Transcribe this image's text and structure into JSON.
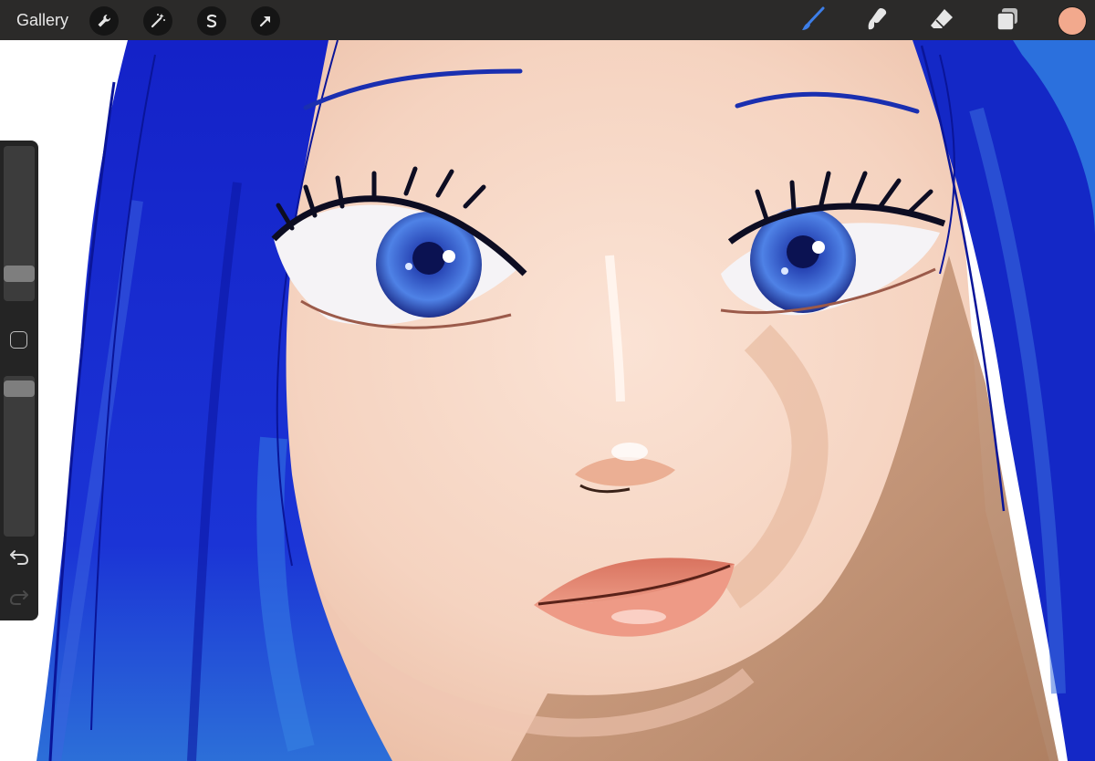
{
  "toolbar": {
    "gallery_label": "Gallery",
    "left_tools": [
      "wrench-icon",
      "magic-wand-icon",
      "selection-s-icon",
      "transform-arrow-icon"
    ],
    "right_tools": [
      "brush-icon",
      "smudge-icon",
      "eraser-icon",
      "layers-icon"
    ],
    "active_tool": "brush-icon",
    "active_tool_color": "#3d7ee8",
    "icon_color": "#e6e6e6"
  },
  "color": {
    "current": "#f2a98d"
  },
  "sidebar": {
    "brush_size_level": 0.14,
    "opacity_level": 0.97,
    "modify_icon": "square-icon",
    "undo_icon": "undo-icon",
    "redo_icon": "redo-icon"
  },
  "artwork": {
    "hair_color": "#1022c4",
    "skin_color": "#f7dbcb",
    "iris_color": "#3158c9",
    "lip_color": "#e2806c"
  }
}
